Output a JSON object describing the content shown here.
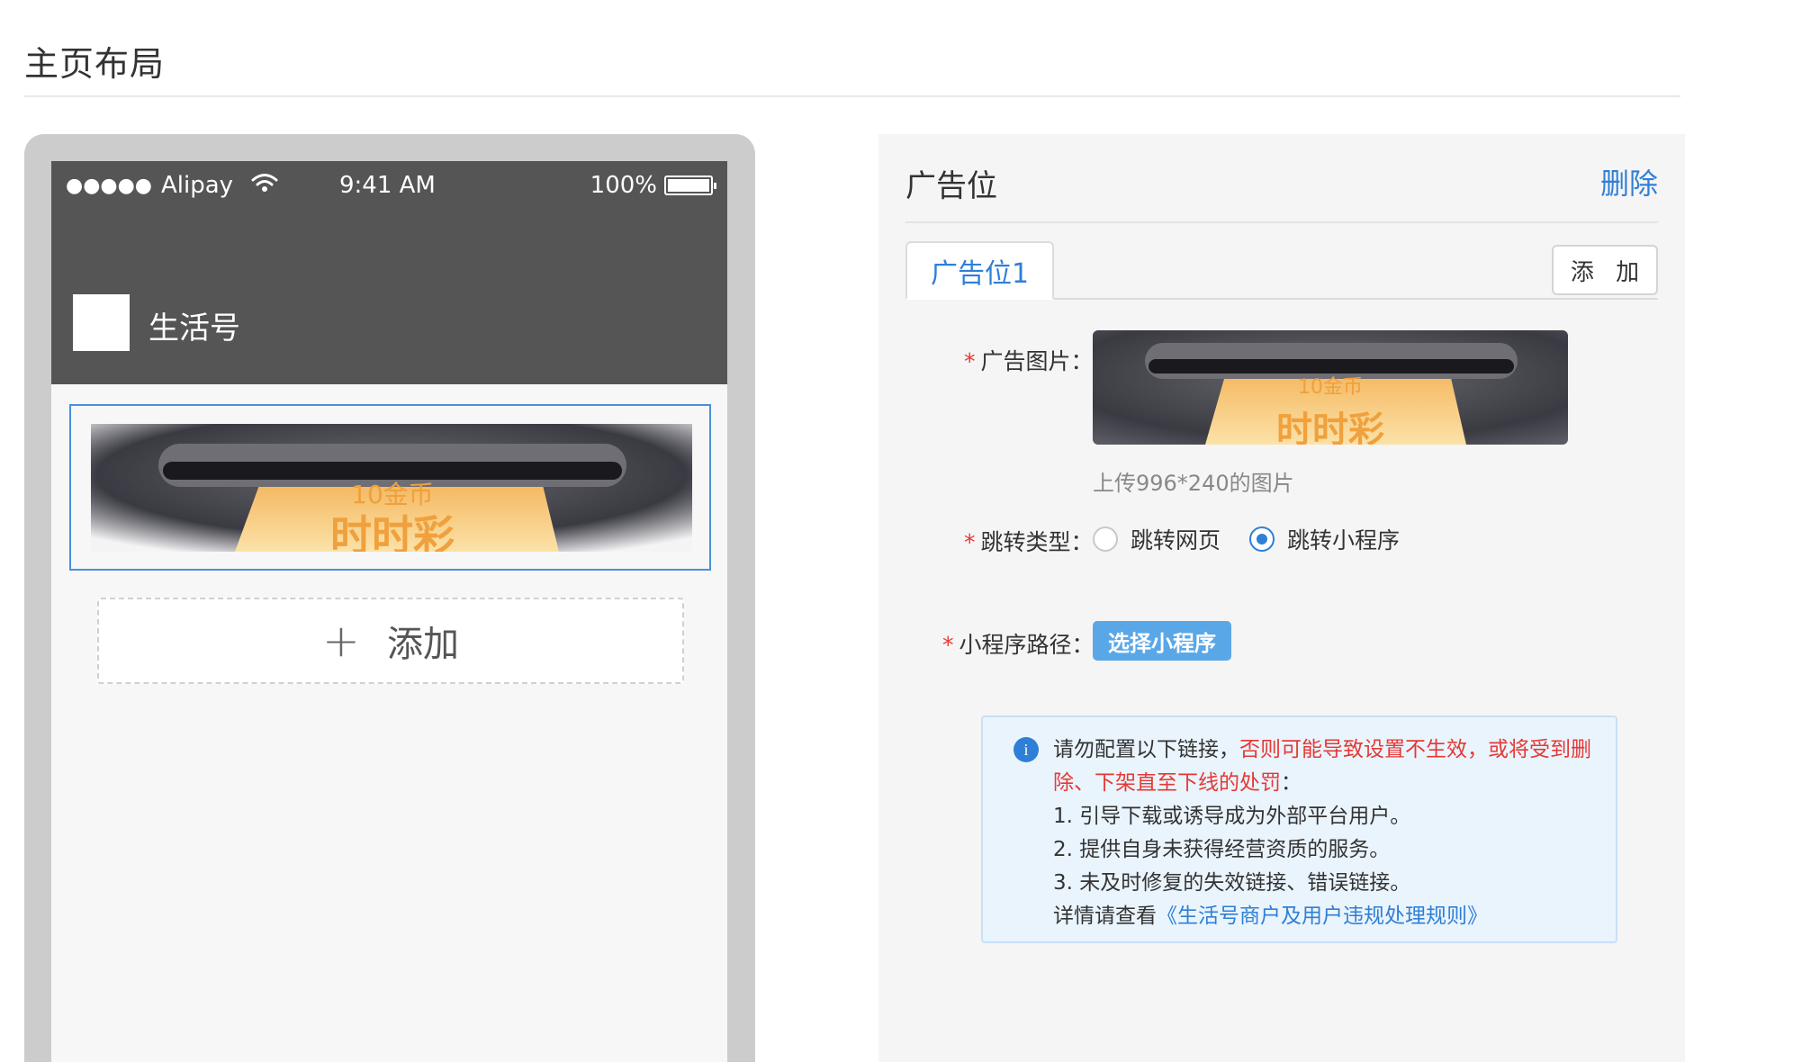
{
  "page": {
    "title": "主页布局"
  },
  "phone": {
    "carrier": "Alipay",
    "signal": "●●●●●",
    "time": "9:41 AM",
    "battery": "100%",
    "account_name": "生活号",
    "add_label": "添加",
    "ad_image": {
      "line1": "10金币",
      "line2": "时时彩"
    }
  },
  "panel": {
    "title": "广告位",
    "delete_label": "删除",
    "tabs": [
      {
        "label": "广告位1"
      }
    ],
    "add_tab_label": "添 加",
    "image_field": {
      "label": "广告图片：",
      "hint": "上传996*240的图片"
    },
    "jump_field": {
      "label": "跳转类型：",
      "options": [
        {
          "label": "跳转网页",
          "checked": false
        },
        {
          "label": "跳转小程序",
          "checked": true
        }
      ]
    },
    "path_field": {
      "label": "小程序路径：",
      "button_label": "选择小程序"
    },
    "notice": {
      "intro": "请勿配置以下链接，",
      "warning": "否则可能导致设置不生效，或将受到删除、下架直至下线的处罚",
      "colon": "：",
      "items": [
        "1. 引导下载或诱导成为外部平台用户。",
        "2. 提供自身未获得经营资质的服务。",
        "3. 未及时修复的失效链接、错误链接。"
      ],
      "more_prefix": "详情请查看",
      "link_text": "《生活号商户及用户违规处理规则》"
    }
  },
  "colors": {
    "accent": "#2f7fd6",
    "warning": "#e53935",
    "header": "#555555",
    "button": "#5aa7e8"
  }
}
